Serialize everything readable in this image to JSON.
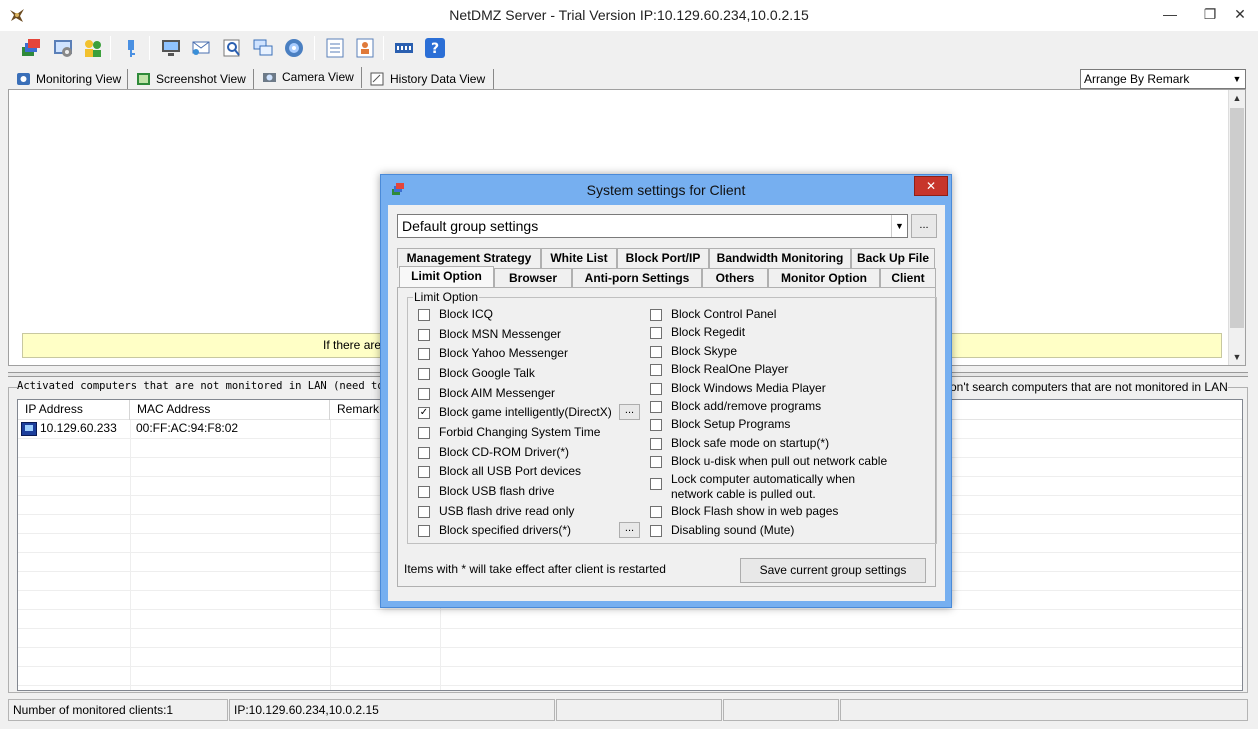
{
  "window": {
    "title": "NetDMZ Server - Trial Version IP:10.129.60.234,10.0.2.15",
    "minimize": "—",
    "maximize": "❐",
    "close": "✕"
  },
  "toolbar": {
    "icons": [
      "groups-icon",
      "settings-icon",
      "users-icon",
      "key-icon",
      "monitor-icon",
      "message-icon",
      "search-icon",
      "chat-icon",
      "disc-icon",
      "report-icon",
      "user-report-icon",
      "network-icon",
      "help-icon"
    ]
  },
  "view_tabs": [
    {
      "label": "Monitoring View",
      "icon": "monitor-tab-icon"
    },
    {
      "label": "Screenshot View",
      "icon": "screenshot-icon"
    },
    {
      "label": "Camera View",
      "icon": "camera-icon"
    },
    {
      "label": "History Data View",
      "icon": "history-icon"
    }
  ],
  "arrange": {
    "selected": "Arrange By Remark"
  },
  "notice": {
    "text": "If there are"
  },
  "lower": {
    "caption_left": "Activated computers that are not monitored in LAN (need to i",
    "caption_right": "on't search computers that are not monitored in LAN",
    "columns": [
      "IP Address",
      "MAC Address",
      "Remark"
    ],
    "rows": [
      {
        "ip": "10.129.60.233",
        "mac": "00:FF:AC:94:F8:02",
        "remark": ""
      }
    ]
  },
  "status": {
    "clients": "Number of monitored clients:1",
    "ip": "IP:10.129.60.234,10.0.2.15"
  },
  "dialog": {
    "title": "System settings for Client",
    "close": "✕",
    "group_combo": "Default group settings",
    "dots": "...",
    "tabs_back": [
      "Management Strategy",
      "White List",
      "Block Port/IP",
      "Bandwidth Monitoring",
      "Back Up File"
    ],
    "tabs_front": [
      "Limit Option",
      "Browser",
      "Anti-porn Settings",
      "Others",
      "Monitor Option",
      "Client"
    ],
    "group_label": "Limit Option",
    "left_options": [
      {
        "label": "Block ICQ",
        "checked": false
      },
      {
        "label": "Block MSN Messenger",
        "checked": false
      },
      {
        "label": "Block Yahoo Messenger",
        "checked": false
      },
      {
        "label": "Block Google Talk",
        "checked": false
      },
      {
        "label": "Block AIM Messenger",
        "checked": false
      },
      {
        "label": "Block game intelligently(DirectX)",
        "checked": true
      },
      {
        "label": "Forbid Changing System Time",
        "checked": false
      },
      {
        "label": "Block CD-ROM Driver(*)",
        "checked": false
      },
      {
        "label": "Block all USB Port devices",
        "checked": false
      },
      {
        "label": "Block USB flash drive",
        "checked": false
      },
      {
        "label": "USB flash drive read only",
        "checked": false
      },
      {
        "label": "Block specified drivers(*)",
        "checked": false
      }
    ],
    "right_options": [
      {
        "label": "Block Control Panel",
        "checked": false
      },
      {
        "label": "Block Regedit",
        "checked": false
      },
      {
        "label": "Block Skype",
        "checked": false
      },
      {
        "label": "Block RealOne Player",
        "checked": false
      },
      {
        "label": "Block Windows Media Player",
        "checked": false
      },
      {
        "label": "Block add/remove programs",
        "checked": false
      },
      {
        "label": "Block Setup Programs",
        "checked": false
      },
      {
        "label": "Block safe mode on startup(*)",
        "checked": false
      },
      {
        "label": "Block u-disk when pull out network cable",
        "checked": false
      },
      {
        "label": "Lock computer automatically when network cable is pulled out.",
        "checked": false
      },
      {
        "label": "Block Flash show in web pages",
        "checked": false
      },
      {
        "label": "Disabling sound (Mute)",
        "checked": false
      }
    ],
    "check_mark": "✓",
    "note": "Items with * will take effect after client is restarted",
    "save_button": "Save current group settings"
  },
  "colors": {
    "dialog_frame": "#76aff0",
    "close_red": "#c7352b",
    "notice_yellow": "#ffffc6"
  }
}
